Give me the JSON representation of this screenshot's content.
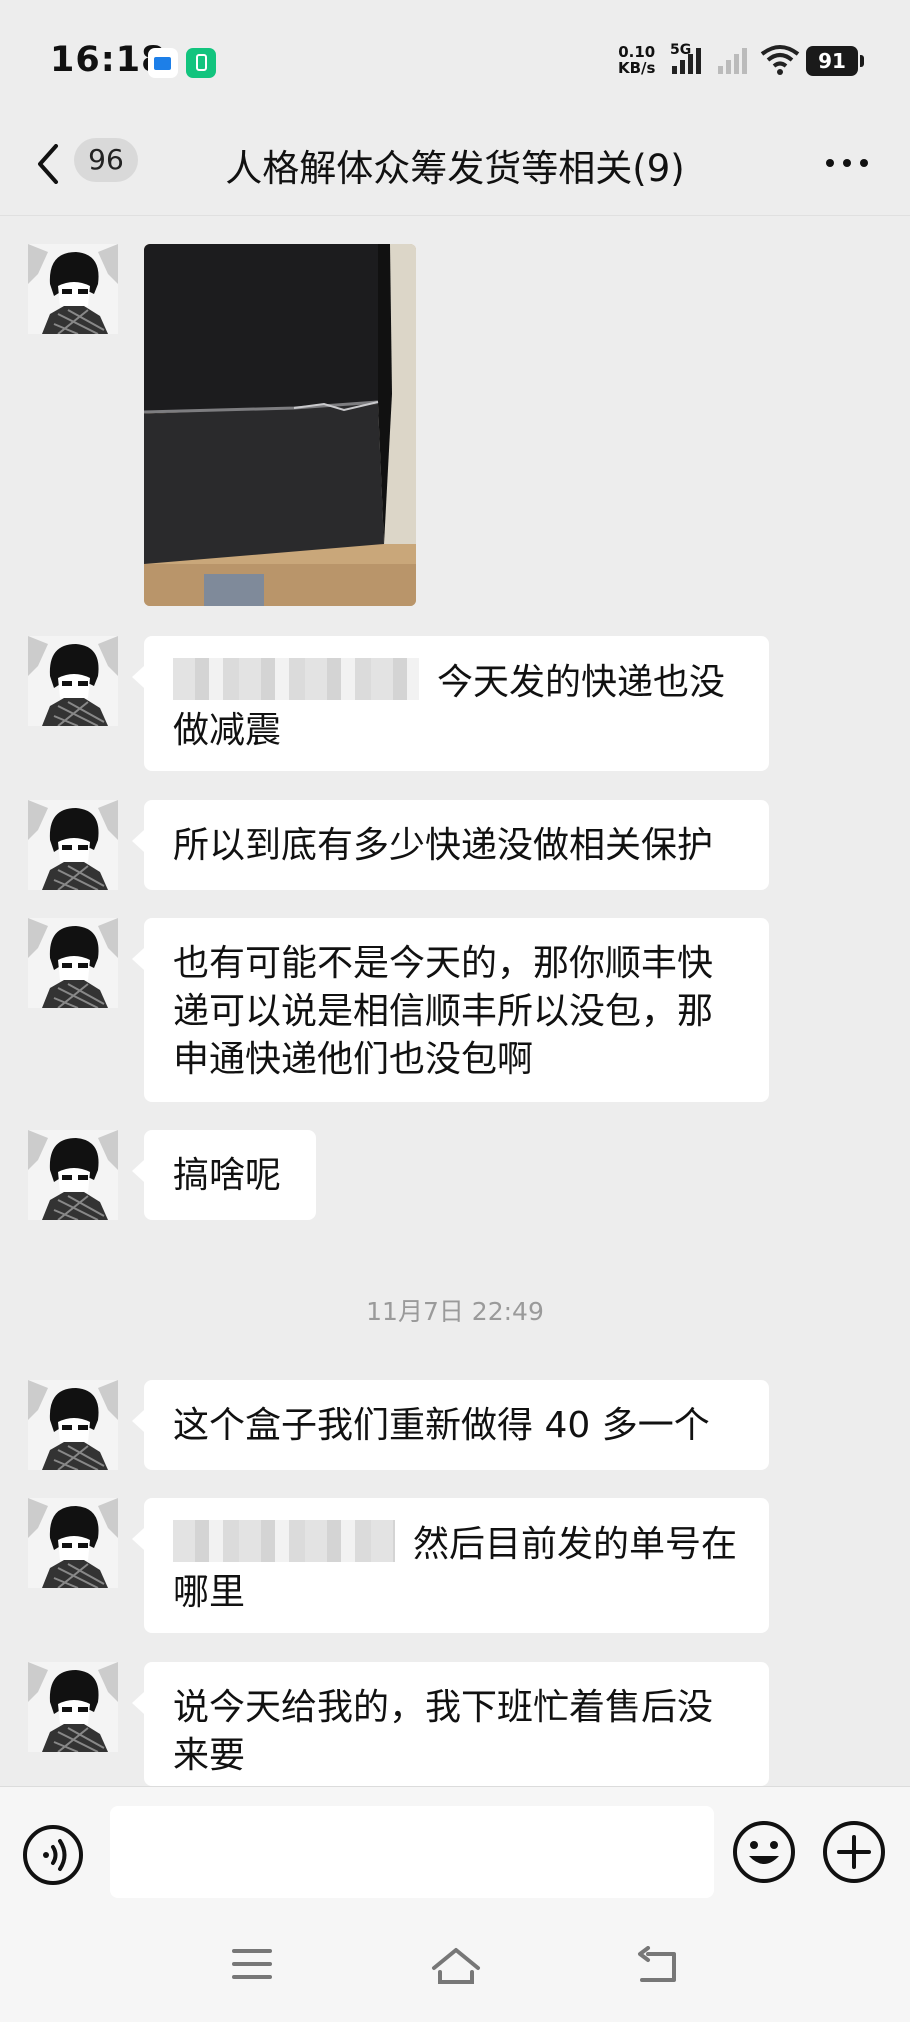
{
  "status": {
    "time": "16:18",
    "net_speed_value": "0.10",
    "net_speed_unit": "KB/s",
    "network": "5G",
    "battery": "91"
  },
  "header": {
    "unread_count": "96",
    "title": "人格解体众筹发货等相关(9)"
  },
  "messages": [
    {
      "type": "image",
      "description": "photo of damaged black box corner"
    },
    {
      "type": "text",
      "lines": [
        "今天发的快递也没",
        "做减震"
      ],
      "redacted": true
    },
    {
      "type": "text",
      "lines": [
        "所以到底有多少快递没做相关保护"
      ]
    },
    {
      "type": "text",
      "lines": [
        "也有可能不是今天的，那你顺丰快",
        "递可以说是相信顺丰所以没包，那",
        "申通快递他们也没包啊"
      ]
    },
    {
      "type": "text",
      "lines": [
        "搞啥呢"
      ]
    },
    {
      "type": "text",
      "lines": [
        "这个盒子我们重新做得 40 多一个"
      ]
    },
    {
      "type": "text",
      "lines": [
        "然后目前发的单号在",
        "哪里"
      ],
      "redacted": true
    },
    {
      "type": "text",
      "lines": [
        "说今天给我的，我下班忙着售后没",
        "来要"
      ]
    }
  ],
  "timestamp": "11月7日 22:49",
  "input": {
    "placeholder": ""
  },
  "colors": {
    "background": "#ededed",
    "bubble": "#ffffff",
    "timestamp": "#9a9a9a"
  }
}
